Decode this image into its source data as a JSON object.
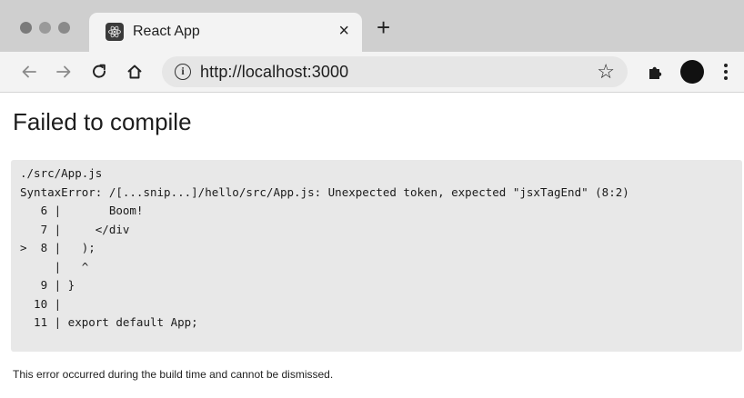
{
  "browser": {
    "tab": {
      "title": "React App",
      "close": "×"
    },
    "new_tab": "+",
    "url": "http://localhost:3000",
    "info_glyph": "i",
    "icons": [
      "back-icon",
      "forward-icon",
      "reload-icon",
      "home-icon",
      "info-icon",
      "star-icon",
      "extensions-icon",
      "profile-avatar",
      "menu-icon"
    ]
  },
  "page": {
    "title": "Failed to compile",
    "error": {
      "lines": [
        "./src/App.js",
        "SyntaxError: /[...snip...]/hello/src/App.js: Unexpected token, expected \"jsxTagEnd\" (8:2)",
        "",
        "   6 |       Boom!",
        "   7 |     </div",
        ">  8 |   );",
        "     |   ^",
        "   9 | }",
        "  10 |",
        "  11 | export default App;"
      ]
    },
    "footer": "This error occurred during the build time and cannot be dismissed."
  }
}
